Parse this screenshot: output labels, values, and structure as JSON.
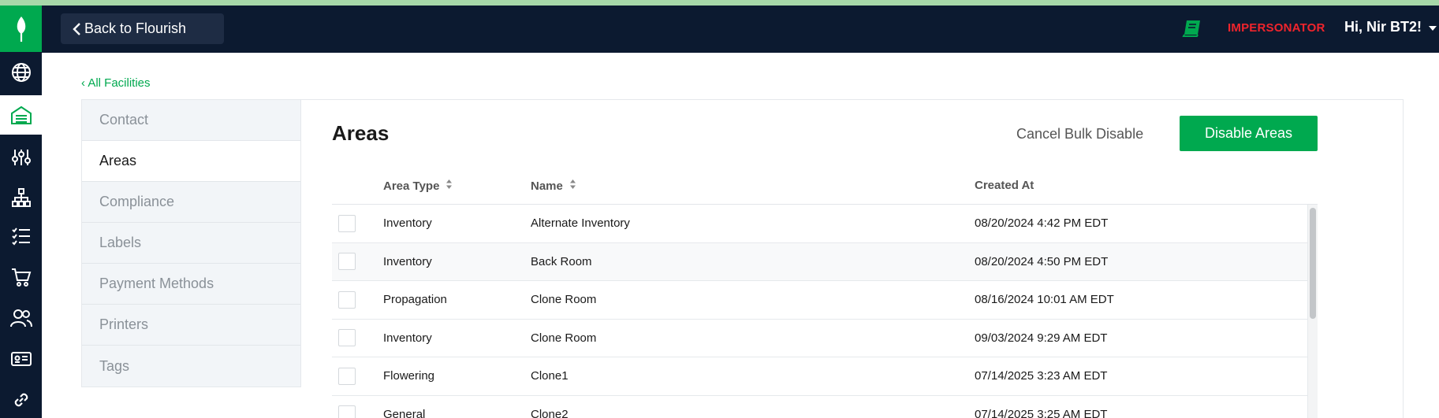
{
  "topbar": {
    "back_label": "Back to Flourish",
    "impersonator_label": "IMPERSONATOR",
    "user_greeting": "Hi, Nir BT2!",
    "book_icon": "book-icon"
  },
  "breadcrumb": {
    "all_facilities": "‹ All Facilities"
  },
  "left_nav": {
    "items": [
      {
        "label": "Contact"
      },
      {
        "label": "Areas"
      },
      {
        "label": "Compliance"
      },
      {
        "label": "Labels"
      },
      {
        "label": "Payment Methods"
      },
      {
        "label": "Printers"
      },
      {
        "label": "Tags"
      }
    ],
    "active": "Areas"
  },
  "main": {
    "title": "Areas",
    "cancel_bulk_label": "Cancel Bulk Disable",
    "disable_button_label": "Disable Areas"
  },
  "table": {
    "columns": [
      "Area Type",
      "Name",
      "Created At"
    ],
    "rows": [
      {
        "area_type": "Inventory",
        "name": "Alternate Inventory",
        "created_at": "08/20/2024 4:42 PM EDT"
      },
      {
        "area_type": "Inventory",
        "name": "Back Room",
        "created_at": "08/20/2024 4:50 PM EDT"
      },
      {
        "area_type": "Propagation",
        "name": "Clone Room",
        "created_at": "08/16/2024 10:01 AM EDT"
      },
      {
        "area_type": "Inventory",
        "name": "Clone Room",
        "created_at": "09/03/2024 9:29 AM EDT"
      },
      {
        "area_type": "Flowering",
        "name": "Clone1",
        "created_at": "07/14/2025 3:23 AM EDT"
      },
      {
        "area_type": "General",
        "name": "Clone2",
        "created_at": "07/14/2025 3:25 AM EDT"
      }
    ]
  },
  "colors": {
    "brand_green": "#00a94f",
    "navy": "#0c1a30",
    "impersonator_red": "#f0242c"
  }
}
